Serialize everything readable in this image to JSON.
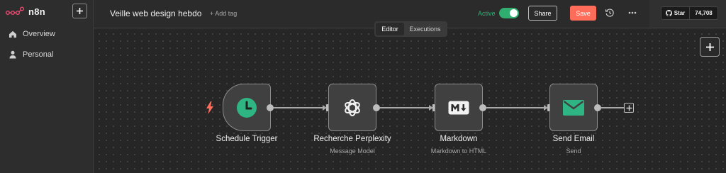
{
  "sidebar": {
    "brand": "n8n",
    "items": [
      {
        "label": "Overview",
        "icon": "home-icon"
      },
      {
        "label": "Personal",
        "icon": "user-icon"
      }
    ]
  },
  "header": {
    "workflow_title": "Veille web design hebdo",
    "add_tag": "+ Add tag",
    "active_label": "Active",
    "share_label": "Share",
    "save_label": "Save"
  },
  "github": {
    "star_label": "Star",
    "star_count": "74,708"
  },
  "canvas": {
    "tabs": [
      {
        "label": "Editor",
        "selected": true
      },
      {
        "label": "Executions",
        "selected": false
      }
    ],
    "nodes": [
      {
        "title": "Schedule Trigger",
        "subtitle": "",
        "icon": "clock-icon"
      },
      {
        "title": "Recherche Perplexity",
        "subtitle": "Message Model",
        "icon": "openai-icon"
      },
      {
        "title": "Markdown",
        "subtitle": "Markdown to HTML",
        "icon": "markdown-icon"
      },
      {
        "title": "Send Email",
        "subtitle": "Send",
        "icon": "envelope-icon"
      }
    ]
  },
  "colors": {
    "accent_save": "#ff6d5a",
    "active_green": "#2fae6f",
    "trigger_green": "#2fb584",
    "bolt_red": "#ff6d5a"
  }
}
